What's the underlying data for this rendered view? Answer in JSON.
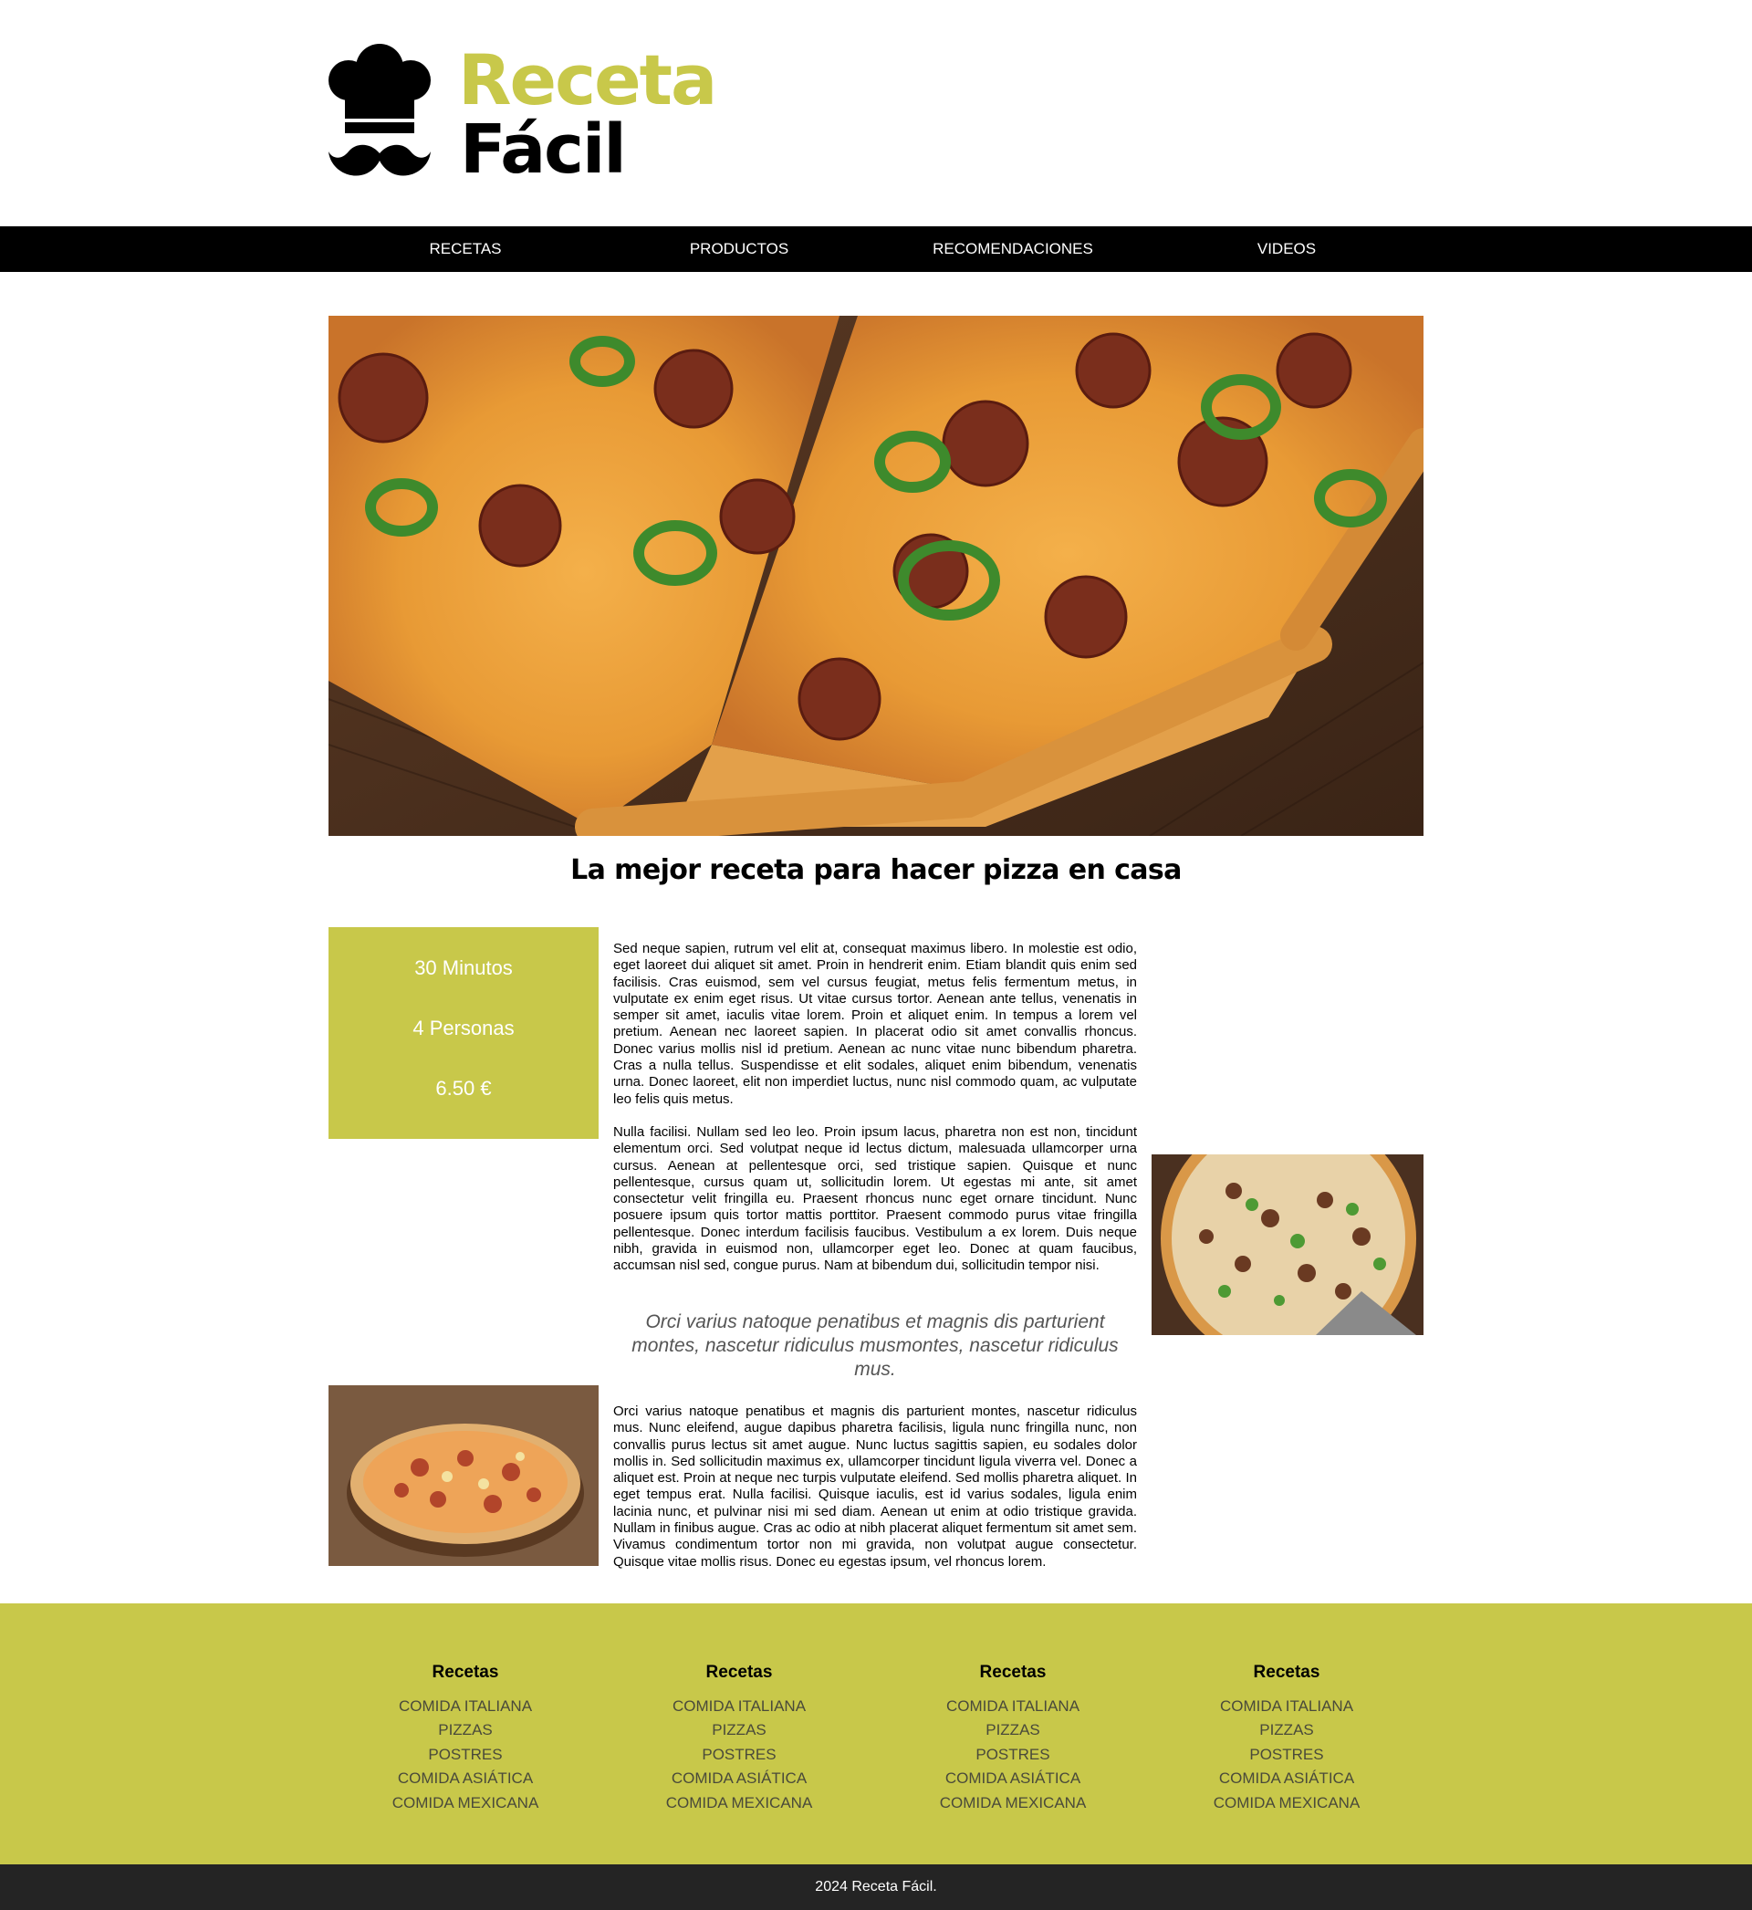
{
  "colors": {
    "accent": "#c8c84a",
    "nav_bg": "#000000",
    "bottom_bar_bg": "#242424",
    "info_text": "#ffffff"
  },
  "logo": {
    "icon": "chef-hat-mustache-icon",
    "word1": "Receta",
    "word2": "Fácil"
  },
  "nav": {
    "items": [
      {
        "label": "RECETAS"
      },
      {
        "label": "PRODUCTOS"
      },
      {
        "label": "RECOMENDACIONES"
      },
      {
        "label": "VIDEOS"
      }
    ]
  },
  "article": {
    "title": "La mejor receta para hacer pizza en casa",
    "info": {
      "time": "30 Minutos",
      "servings": "4 Personas",
      "price": "6.50 €"
    },
    "paragraph1": "Sed neque sapien, rutrum vel elit at, consequat maximus libero. In molestie est odio, eget laoreet dui aliquet sit amet. Proin in hendrerit enim. Etiam blandit quis enim sed facilisis. Cras euismod, sem vel cursus feugiat, metus felis fermentum metus, in vulputate ex enim eget risus. Ut vitae cursus tortor. Aenean ante tellus, venenatis in semper sit amet, iaculis vitae lorem. Proin et aliquet enim. In tempus a lorem vel pretium. Aenean nec laoreet sapien. In placerat odio sit amet convallis rhoncus. Donec varius mollis nisl id pretium. Aenean ac nunc vitae nunc bibendum pharetra. Cras a nulla tellus. Suspendisse et elit sodales, aliquet enim bibendum, venenatis urna. Donec laoreet, elit non imperdiet luctus, nunc nisl commodo quam, ac vulputate leo felis quis metus.",
    "paragraph2": "Nulla facilisi. Nullam sed leo leo. Proin ipsum lacus, pharetra non est non, tincidunt elementum orci. Sed volutpat neque id lectus dictum, malesuada ullamcorper urna cursus. Aenean at pellentesque orci, sed tristique sapien. Quisque et nunc pellentesque, cursus quam ut, sollicitudin lorem. Ut egestas mi ante, sit amet consectetur velit fringilla eu. Praesent rhoncus nunc eget ornare tincidunt. Nunc posuere ipsum quis tortor mattis porttitor. Praesent commodo purus vitae fringilla pellentesque. Donec interdum facilisis faucibus. Vestibulum a ex lorem. Duis neque nibh, gravida in euismod non, ullamcorper eget leo. Donec at quam faucibus, accumsan nisl sed, congue purus. Nam at bibendum dui, sollicitudin tempor nisi.",
    "quote": "Orci varius natoque penatibus et magnis dis parturient montes, nascetur ridiculus musmontes, nascetur ridiculus mus.",
    "paragraph3": "Orci varius natoque penatibus et magnis dis parturient montes, nascetur ridiculus mus. Nunc eleifend, augue dapibus pharetra facilisis, ligula nunc fringilla nunc, non convallis purus lectus sit amet augue. Nunc luctus sagittis sapien, eu sodales dolor mollis in. Sed sollicitudin maximus ex, ullamcorper tincidunt ligula viverra vel. Donec a aliquet est. Proin at neque nec turpis vulputate eleifend. Sed mollis pharetra aliquet. In eget tempus erat. Nulla facilisi. Quisque iaculis, est id varius sodales, ligula enim lacinia nunc, et pulvinar nisi mi sed diam. Aenean ut enim at odio tristique gravida. Nullam in finibus augue. Cras ac odio at nibh placerat aliquet fermentum sit amet sem. Vivamus condimentum tortor non mi gravida, non volutpat augue consectetur. Quisque vitae mollis risus. Donec eu egestas ipsum, vel rhoncus lorem."
  },
  "footer": {
    "columns": [
      {
        "title": "Recetas",
        "links": [
          "COMIDA ITALIANA",
          "PIZZAS",
          "POSTRES",
          "COMIDA ASIÁTICA",
          "COMIDA MEXICANA"
        ]
      },
      {
        "title": "Recetas",
        "links": [
          "COMIDA ITALIANA",
          "PIZZAS",
          "POSTRES",
          "COMIDA ASIÁTICA",
          "COMIDA MEXICANA"
        ]
      },
      {
        "title": "Recetas",
        "links": [
          "COMIDA ITALIANA",
          "PIZZAS",
          "POSTRES",
          "COMIDA ASIÁTICA",
          "COMIDA MEXICANA"
        ]
      },
      {
        "title": "Recetas",
        "links": [
          "COMIDA ITALIANA",
          "PIZZAS",
          "POSTRES",
          "COMIDA ASIÁTICA",
          "COMIDA MEXICANA"
        ]
      }
    ],
    "copyright": "2024 Receta Fácil."
  }
}
